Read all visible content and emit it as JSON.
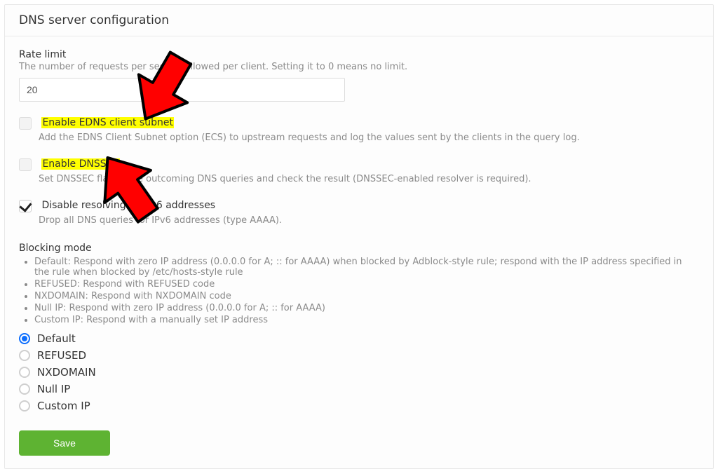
{
  "header": {
    "title": "DNS server configuration"
  },
  "rate_limit": {
    "label": "Rate limit",
    "desc": "The number of requests per second allowed per client. Setting it to 0 means no limit.",
    "value": "20"
  },
  "checkboxes": {
    "edns": {
      "checked": false,
      "highlight": true,
      "label": "Enable EDNS client subnet",
      "desc": "Add the EDNS Client Subnet option (ECS) to upstream requests and log the values sent by the clients in the query log."
    },
    "dnssec": {
      "checked": false,
      "highlight": true,
      "label": "Enable DNSSEC",
      "desc": "Set DNSSEC flag in the outcoming DNS queries and check the result (DNSSEC-enabled resolver is required)."
    },
    "disable_ipv6": {
      "checked": true,
      "highlight": false,
      "label": "Disable resolving of IPv6 addresses",
      "desc": "Drop all DNS queries for IPv6 addresses (type AAAA)."
    }
  },
  "blocking_mode": {
    "title": "Blocking mode",
    "descriptions": [
      "Default: Respond with zero IP address (0.0.0.0 for A; :: for AAAA) when blocked by Adblock-style rule; respond with the IP address specified in the rule when blocked by /etc/hosts-style rule",
      "REFUSED: Respond with REFUSED code",
      "NXDOMAIN: Respond with NXDOMAIN code",
      "Null IP: Respond with zero IP address (0.0.0.0 for A; :: for AAAA)",
      "Custom IP: Respond with a manually set IP address"
    ],
    "options": [
      {
        "label": "Default",
        "selected": true
      },
      {
        "label": "REFUSED",
        "selected": false
      },
      {
        "label": "NXDOMAIN",
        "selected": false
      },
      {
        "label": "Null IP",
        "selected": false
      },
      {
        "label": "Custom IP",
        "selected": false
      }
    ]
  },
  "buttons": {
    "save": "Save"
  }
}
